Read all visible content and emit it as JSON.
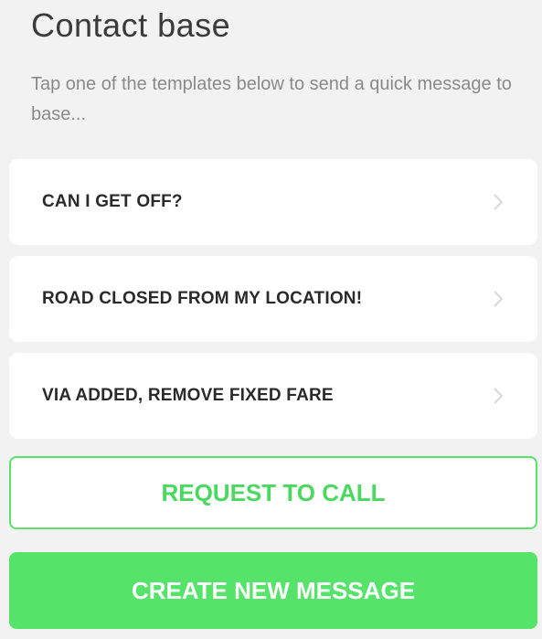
{
  "header": {
    "title": "Contact base",
    "subtitle": "Tap one of the templates below to send a quick message to base..."
  },
  "templates": [
    {
      "label": "CAN I GET OFF?"
    },
    {
      "label": "ROAD CLOSED FROM MY LOCATION!"
    },
    {
      "label": "VIA ADDED, REMOVE FIXED FARE"
    }
  ],
  "actions": {
    "request_call_label": "REQUEST TO CALL",
    "create_message_label": "CREATE NEW MESSAGE"
  },
  "colors": {
    "accent": "#56e36a",
    "accent_text": "#4bd85f",
    "background": "#f2f2f2",
    "card": "#ffffff"
  },
  "icons": {
    "template_chevron": "chevron-right-icon"
  }
}
